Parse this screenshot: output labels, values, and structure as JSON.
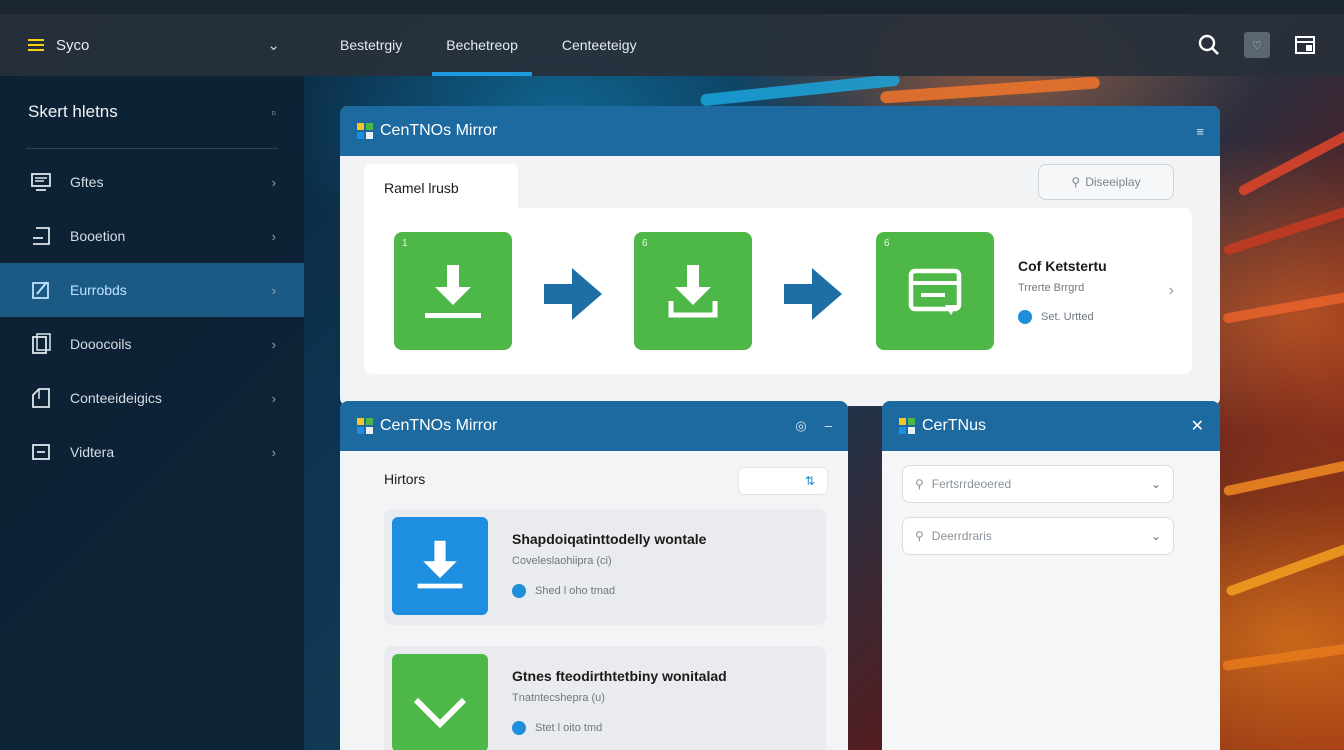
{
  "header": {
    "brand_label": "Syco",
    "tabs": [
      {
        "label": "Bestetrgiy"
      },
      {
        "label": "Bechetreop"
      },
      {
        "label": "Centeeteigy"
      }
    ],
    "active_tab_index": 1
  },
  "sidebar": {
    "title": "Skert hletns",
    "items": [
      {
        "label": "Gftes",
        "icon": "monitor-icon"
      },
      {
        "label": "Booetion",
        "icon": "import-icon"
      },
      {
        "label": "Eurrobds",
        "icon": "edit-icon"
      },
      {
        "label": "Dooocoils",
        "icon": "documents-icon"
      },
      {
        "label": "Conteeideigics",
        "icon": "folder-icon"
      },
      {
        "label": "Vidtera",
        "icon": "export-icon"
      }
    ],
    "active_index": 2
  },
  "main_panel": {
    "title": "CenTNOs Mirror",
    "tab_label": "Ramel lrusb",
    "search_label": "Diseeiplay",
    "steps": [
      {
        "number": "1",
        "icon": "download-icon"
      },
      {
        "number": "6",
        "icon": "download-icon"
      },
      {
        "number": "6",
        "icon": "window-icon"
      }
    ],
    "final_step": {
      "title": "Cof Ketstertu",
      "subtitle": "Trrerte Brrgrd",
      "status": "Set. Urtted"
    }
  },
  "mirror_panel": {
    "title": "CenTNOs Mirror",
    "section_title": "Hirtors",
    "items": [
      {
        "title": "Shapdoiqatinttodelly wontale",
        "subtitle": "Coveleslaohiipra (ci)",
        "status": "Shed l oho tmad",
        "icon": "download-icon"
      },
      {
        "title": "Gtnes fteodirthtetbiny wonitalad",
        "subtitle": "Tnatntecshepra (u)",
        "status": "Stet l oito tmd",
        "icon": "check-icon"
      }
    ]
  },
  "side_panel": {
    "title": "CerTNus",
    "dropdowns": [
      {
        "placeholder": "Fertsrrdeoered"
      },
      {
        "placeholder": "Deerrdraris"
      }
    ]
  },
  "colors": {
    "accent_blue": "#1d6aa0",
    "success_green": "#4db847",
    "download_blue": "#1e8fe0",
    "brand_yellow": "#f3d21a"
  }
}
